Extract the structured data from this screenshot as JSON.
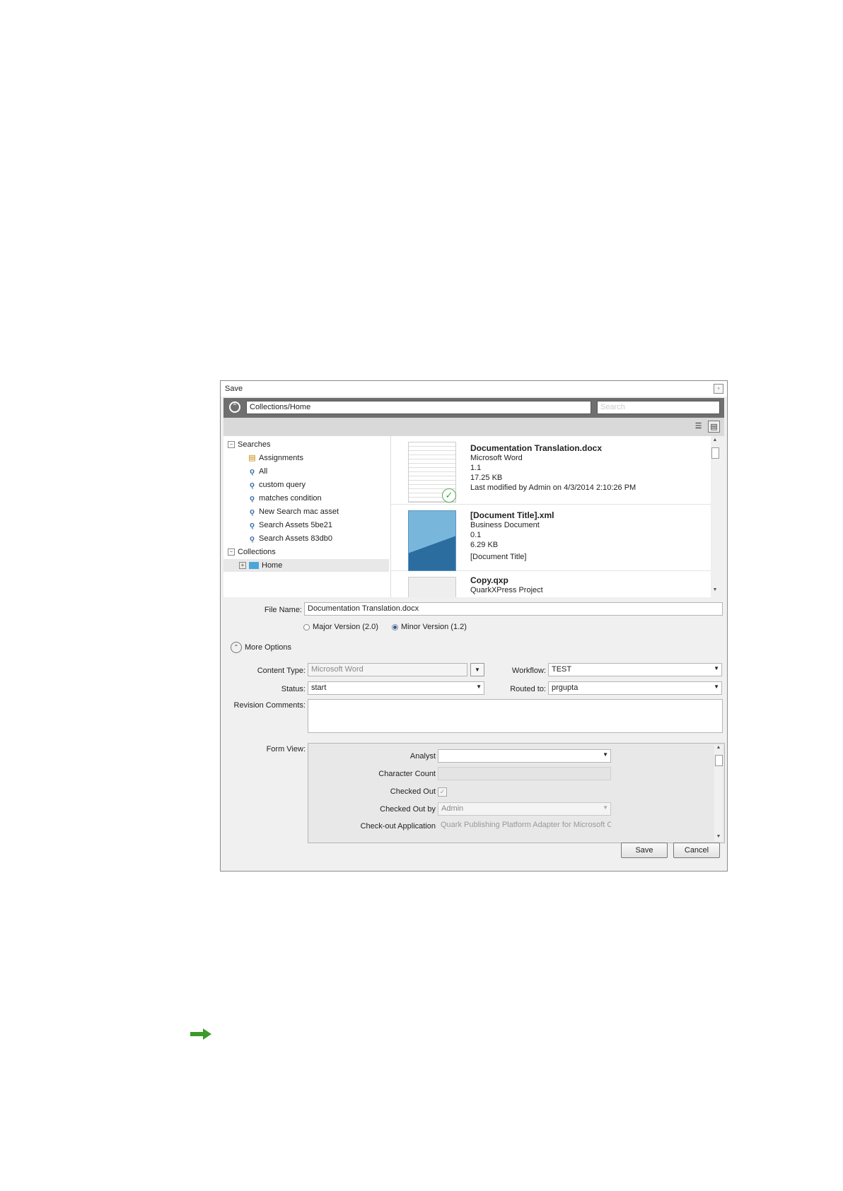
{
  "window": {
    "title": "Save"
  },
  "pathbar": {
    "path": "Collections/Home",
    "search_placeholder": "Search"
  },
  "tree": {
    "searches_label": "Searches",
    "searches": [
      "Assignments",
      "All",
      "custom query",
      "matches condition",
      "New Search mac asset",
      "Search Assets 5be21",
      "Search Assets 83db0"
    ],
    "collections_label": "Collections",
    "home_label": "Home"
  },
  "files": [
    {
      "name": "Documentation Translation.docx",
      "type": "Microsoft Word",
      "version": "1.1",
      "size": "17.25 KB",
      "extra": "Last modified by Admin on 4/3/2014 2:10:26 PM"
    },
    {
      "name": "[Document Title].xml",
      "type": "Business Document",
      "version": "0.1",
      "size": "6.29 KB",
      "extra": "[Document Title]"
    },
    {
      "name": "Copy.qxp",
      "type": "QuarkXPress Project"
    }
  ],
  "form": {
    "file_name_label": "File Name:",
    "file_name_value": "Documentation Translation.docx",
    "major_version": "Major Version (2.0)",
    "minor_version": "Minor Version (1.2)",
    "more_options": "More Options",
    "content_type_label": "Content Type:",
    "content_type_value": "Microsoft Word",
    "workflow_label": "Workflow:",
    "workflow_value": "TEST",
    "status_label": "Status:",
    "status_value": "start",
    "routed_to_label": "Routed to:",
    "routed_to_value": "prgupta",
    "revision_comments_label": "Revision Comments:",
    "form_view_label": "Form View:"
  },
  "form_view": {
    "analyst_label": "Analyst",
    "character_count_label": "Character Count",
    "checked_out_label": "Checked Out",
    "checked_out_by_label": "Checked Out by",
    "checked_out_by_value": "Admin",
    "checkout_app_label": "Check-out Application",
    "checkout_app_value": "Quark Publishing Platform Adapter for Microsoft O"
  },
  "buttons": {
    "save": "Save",
    "cancel": "Cancel"
  },
  "colors": {
    "accent_arrow": "#3a9a2a",
    "radio_selected": "#2a5aa8"
  }
}
